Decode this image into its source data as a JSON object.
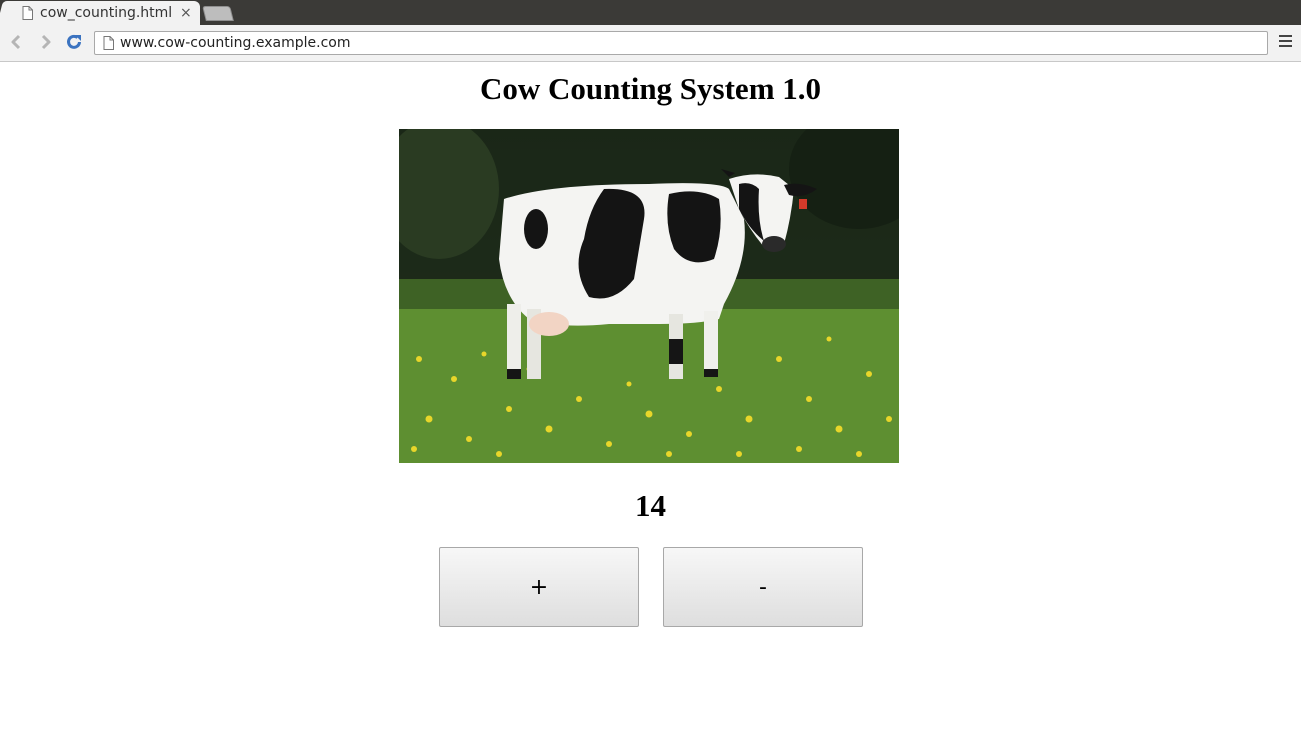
{
  "browser": {
    "tab_title": "cow_counting.html",
    "tab_close": "×",
    "url": "www.cow-counting.example.com",
    "icons": [
      "document-icon",
      "close-icon",
      "back-icon",
      "forward-icon",
      "reload-icon",
      "menu-icon"
    ]
  },
  "page": {
    "title": "Cow Counting System 1.0",
    "image": "holstein-cow-in-dandelion-field",
    "count": "14",
    "increment_label": "+",
    "decrement_label": "-"
  },
  "colors": {
    "tabstrip": "#3b3a37",
    "toolbar": "#f2f2f2",
    "reload_blue": "#3b73c0"
  }
}
